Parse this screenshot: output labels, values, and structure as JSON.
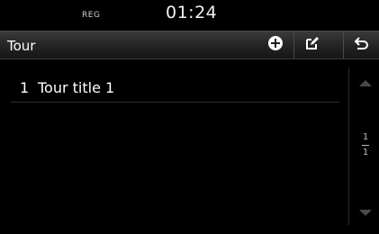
{
  "status": {
    "reg": "REG",
    "time": "01:24"
  },
  "header": {
    "title": "Tour",
    "add_icon": "plus-circle-icon",
    "edit_icon": "edit-icon",
    "back_icon": "back-icon"
  },
  "list": {
    "items": [
      {
        "number": "1",
        "title": "Tour title 1"
      }
    ]
  },
  "pagination": {
    "current": "1",
    "total": "1"
  },
  "colors": {
    "background": "#000000",
    "text": "#ffffff",
    "muted": "#4a4a4a"
  }
}
